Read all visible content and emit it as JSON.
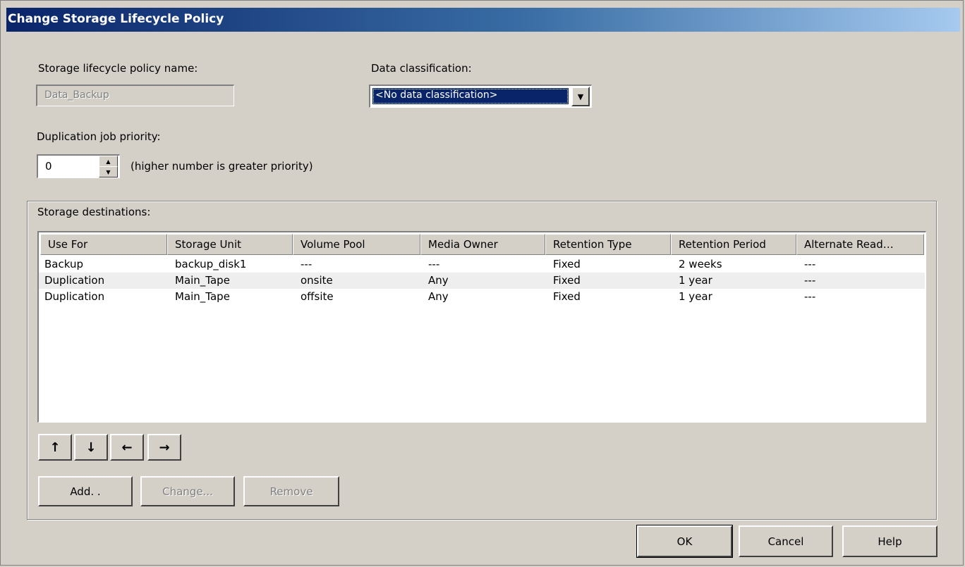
{
  "dialog": {
    "title": "Change Storage Lifecycle Policy"
  },
  "policy_name": {
    "label": "Storage lifecycle policy name:",
    "value": "Data_Backup"
  },
  "classification": {
    "label": "Data classification:",
    "value": "<No data classification>"
  },
  "priority": {
    "label": "Duplication job priority:",
    "value": "0",
    "hint": "(higher number is greater priority)"
  },
  "destinations": {
    "label": "Storage destinations:",
    "columns": [
      "Use For",
      "Storage Unit",
      "Volume Pool",
      "Media Owner",
      "Retention Type",
      "Retention Period",
      "Alternate Read…"
    ],
    "rows": [
      [
        "Backup",
        "backup_disk1",
        "---",
        "---",
        "Fixed",
        "2 weeks",
        "---"
      ],
      [
        "Duplication",
        "Main_Tape",
        "onsite",
        "Any",
        "Fixed",
        "1 year",
        "---"
      ],
      [
        "Duplication",
        "Main_Tape",
        "offsite",
        "Any",
        "Fixed",
        "1 year",
        "---"
      ]
    ],
    "move_buttons": [
      "↑",
      "↓",
      "←",
      "→"
    ],
    "add_label": "Add. .",
    "change_label": "Change...",
    "remove_label": "Remove"
  },
  "footer": {
    "ok_label": "OK",
    "cancel_label": "Cancel",
    "help_label": "Help"
  }
}
